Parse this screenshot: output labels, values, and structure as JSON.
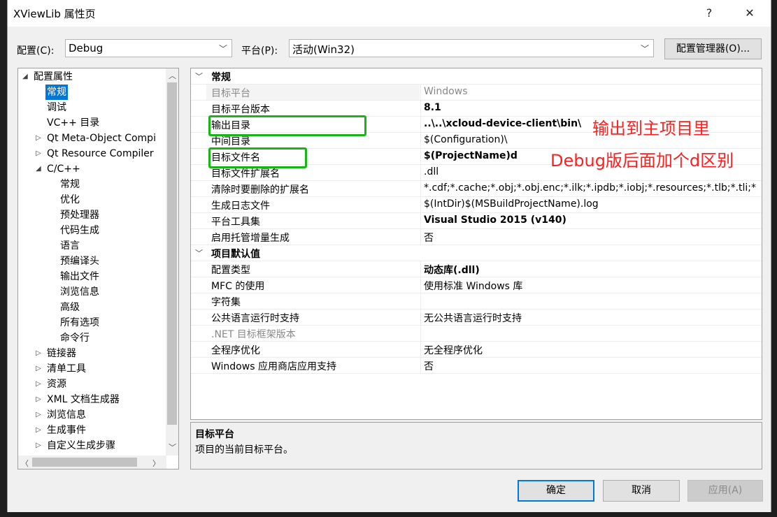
{
  "window": {
    "title": "XViewLib 属性页",
    "help_label": "?",
    "close_label": "✕"
  },
  "config": {
    "config_label": "配置(C):",
    "config_value": "Debug",
    "platform_label": "平台(P):",
    "platform_value": "活动(Win32)",
    "manager_button": "配置管理器(O)..."
  },
  "tree": {
    "items": [
      {
        "label": "配置属性",
        "expander": "◢"
      },
      {
        "label": "常规",
        "expander": ""
      },
      {
        "label": "调试",
        "expander": ""
      },
      {
        "label": "VC++ 目录",
        "expander": ""
      },
      {
        "label": "Qt Meta-Object Compi",
        "expander": "▷"
      },
      {
        "label": "Qt Resource Compiler",
        "expander": "▷"
      },
      {
        "label": "C/C++",
        "expander": "◢"
      },
      {
        "label": "常规",
        "expander": ""
      },
      {
        "label": "优化",
        "expander": ""
      },
      {
        "label": "预处理器",
        "expander": ""
      },
      {
        "label": "代码生成",
        "expander": ""
      },
      {
        "label": "语言",
        "expander": ""
      },
      {
        "label": "预编译头",
        "expander": ""
      },
      {
        "label": "输出文件",
        "expander": ""
      },
      {
        "label": "浏览信息",
        "expander": ""
      },
      {
        "label": "高级",
        "expander": ""
      },
      {
        "label": "所有选项",
        "expander": ""
      },
      {
        "label": "命令行",
        "expander": ""
      },
      {
        "label": "链接器",
        "expander": "▷"
      },
      {
        "label": "清单工具",
        "expander": "▷"
      },
      {
        "label": "资源",
        "expander": "▷"
      },
      {
        "label": "XML 文档生成器",
        "expander": "▷"
      },
      {
        "label": "浏览信息",
        "expander": "▷"
      },
      {
        "label": "生成事件",
        "expander": "▷"
      },
      {
        "label": "自定义生成步骤",
        "expander": "▷"
      }
    ]
  },
  "grid": {
    "rows": [
      {
        "type": "cat",
        "name": "常规",
        "value": ""
      },
      {
        "type": "prop",
        "name": "目标平台",
        "value": "Windows",
        "dim": true,
        "bold": false
      },
      {
        "type": "prop",
        "name": "目标平台版本",
        "value": "8.1",
        "dim": false,
        "bold": true
      },
      {
        "type": "prop",
        "name": "输出目录",
        "value": "..\\..\\xcloud-device-client\\bin\\",
        "dim": false,
        "bold": true
      },
      {
        "type": "prop",
        "name": "中间目录",
        "value": "$(Configuration)\\",
        "dim": false,
        "bold": false
      },
      {
        "type": "prop",
        "name": "目标文件名",
        "value": "$(ProjectName)d",
        "dim": false,
        "bold": true
      },
      {
        "type": "prop",
        "name": "目标文件扩展名",
        "value": ".dll",
        "dim": false,
        "bold": false
      },
      {
        "type": "prop",
        "name": "清除时要删除的扩展名",
        "value": "*.cdf;*.cache;*.obj;*.obj.enc;*.ilk;*.ipdb;*.iobj;*.resources;*.tlb;*.tli;*",
        "dim": false,
        "bold": false
      },
      {
        "type": "prop",
        "name": "生成日志文件",
        "value": "$(IntDir)$(MSBuildProjectName).log",
        "dim": false,
        "bold": false
      },
      {
        "type": "prop",
        "name": "平台工具集",
        "value": "Visual Studio 2015 (v140)",
        "dim": false,
        "bold": true
      },
      {
        "type": "prop",
        "name": "启用托管增量生成",
        "value": "否",
        "dim": false,
        "bold": false
      },
      {
        "type": "cat",
        "name": "项目默认值",
        "value": ""
      },
      {
        "type": "prop",
        "name": "配置类型",
        "value": "动态库(.dll)",
        "dim": false,
        "bold": true
      },
      {
        "type": "prop",
        "name": "MFC 的使用",
        "value": "使用标准 Windows 库",
        "dim": false,
        "bold": false
      },
      {
        "type": "prop",
        "name": "字符集",
        "value": "",
        "dim": false,
        "bold": false
      },
      {
        "type": "prop",
        "name": "公共语言运行时支持",
        "value": "无公共语言运行时支持",
        "dim": false,
        "bold": false
      },
      {
        "type": "prop",
        "name": ".NET 目标框架版本",
        "value": "",
        "dim": true,
        "bold": false
      },
      {
        "type": "prop",
        "name": "全程序优化",
        "value": "无全程序优化",
        "dim": false,
        "bold": false
      },
      {
        "type": "prop",
        "name": "Windows 应用商店应用支持",
        "value": "否",
        "dim": false,
        "bold": false
      }
    ]
  },
  "description": {
    "heading": "目标平台",
    "text": "项目的当前目标平台。"
  },
  "annotations": {
    "output_note": "输出到主项目里",
    "debug_note": "Debug版后面加个d区别",
    "highlight_color": "#18b418",
    "note_color": "#ff2020"
  },
  "buttons": {
    "ok": "确定",
    "cancel": "取消",
    "apply": "应用(A)"
  },
  "colors": {
    "selection": "#0078d7",
    "dialog_bg": "#f0f0f0"
  }
}
